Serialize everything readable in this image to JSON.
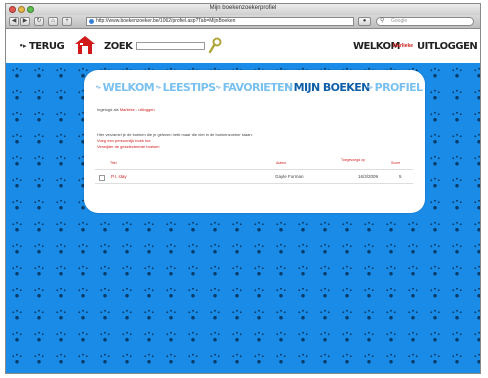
{
  "browser": {
    "window_title": "Mijn boekenzoekerprofiel",
    "url": "http://www.boekenzoeker.be/1062/profiel.asp?Tab=MijnBoeken",
    "search_placeholder": "Google",
    "colors": {
      "close": "#e4574f",
      "minimize": "#e9b948",
      "zoom": "#5fc04d"
    }
  },
  "site": {
    "back_label": "TERUG",
    "search_label": "ZOEK",
    "search_value": "",
    "welcome_label": "WELKOM",
    "user_name": "Marlieke",
    "logout_label": "UITLOGGEN",
    "colors": {
      "accent_red": "#d01a1a",
      "background_blue": "#1a8ce8",
      "nav_light": "#7ac1ef",
      "nav_active": "#0f5fa8"
    }
  },
  "tabs": [
    {
      "label": "WELKOM",
      "active": false
    },
    {
      "label": "LEESTIPS",
      "active": false
    },
    {
      "label": "FAVORIETEN",
      "active": false
    },
    {
      "label": "MIJN BOEKEN",
      "active": true
    },
    {
      "label": "PROFIEL",
      "active": false
    }
  ],
  "profile": {
    "logged_in_prefix": "Ingelogd als",
    "user": "Marlieke",
    "logout_link": "uitloggen",
    "intro": "Hier verzamel je de boeken die je gelezen hebt maar die niet in de boekenzoeker staan:",
    "add_link": "Voeg een persoonlijk boek toe",
    "remove_link": "Verwijder de geselecteerde boeken",
    "table": {
      "headers": [
        "Titel",
        "Auteur",
        "Toegevoegd op",
        "Score"
      ],
      "rows": [
        {
          "title": "P.I. stay",
          "author": "Gayle Forman",
          "added": "16/3/2009",
          "score": "5"
        }
      ]
    }
  }
}
